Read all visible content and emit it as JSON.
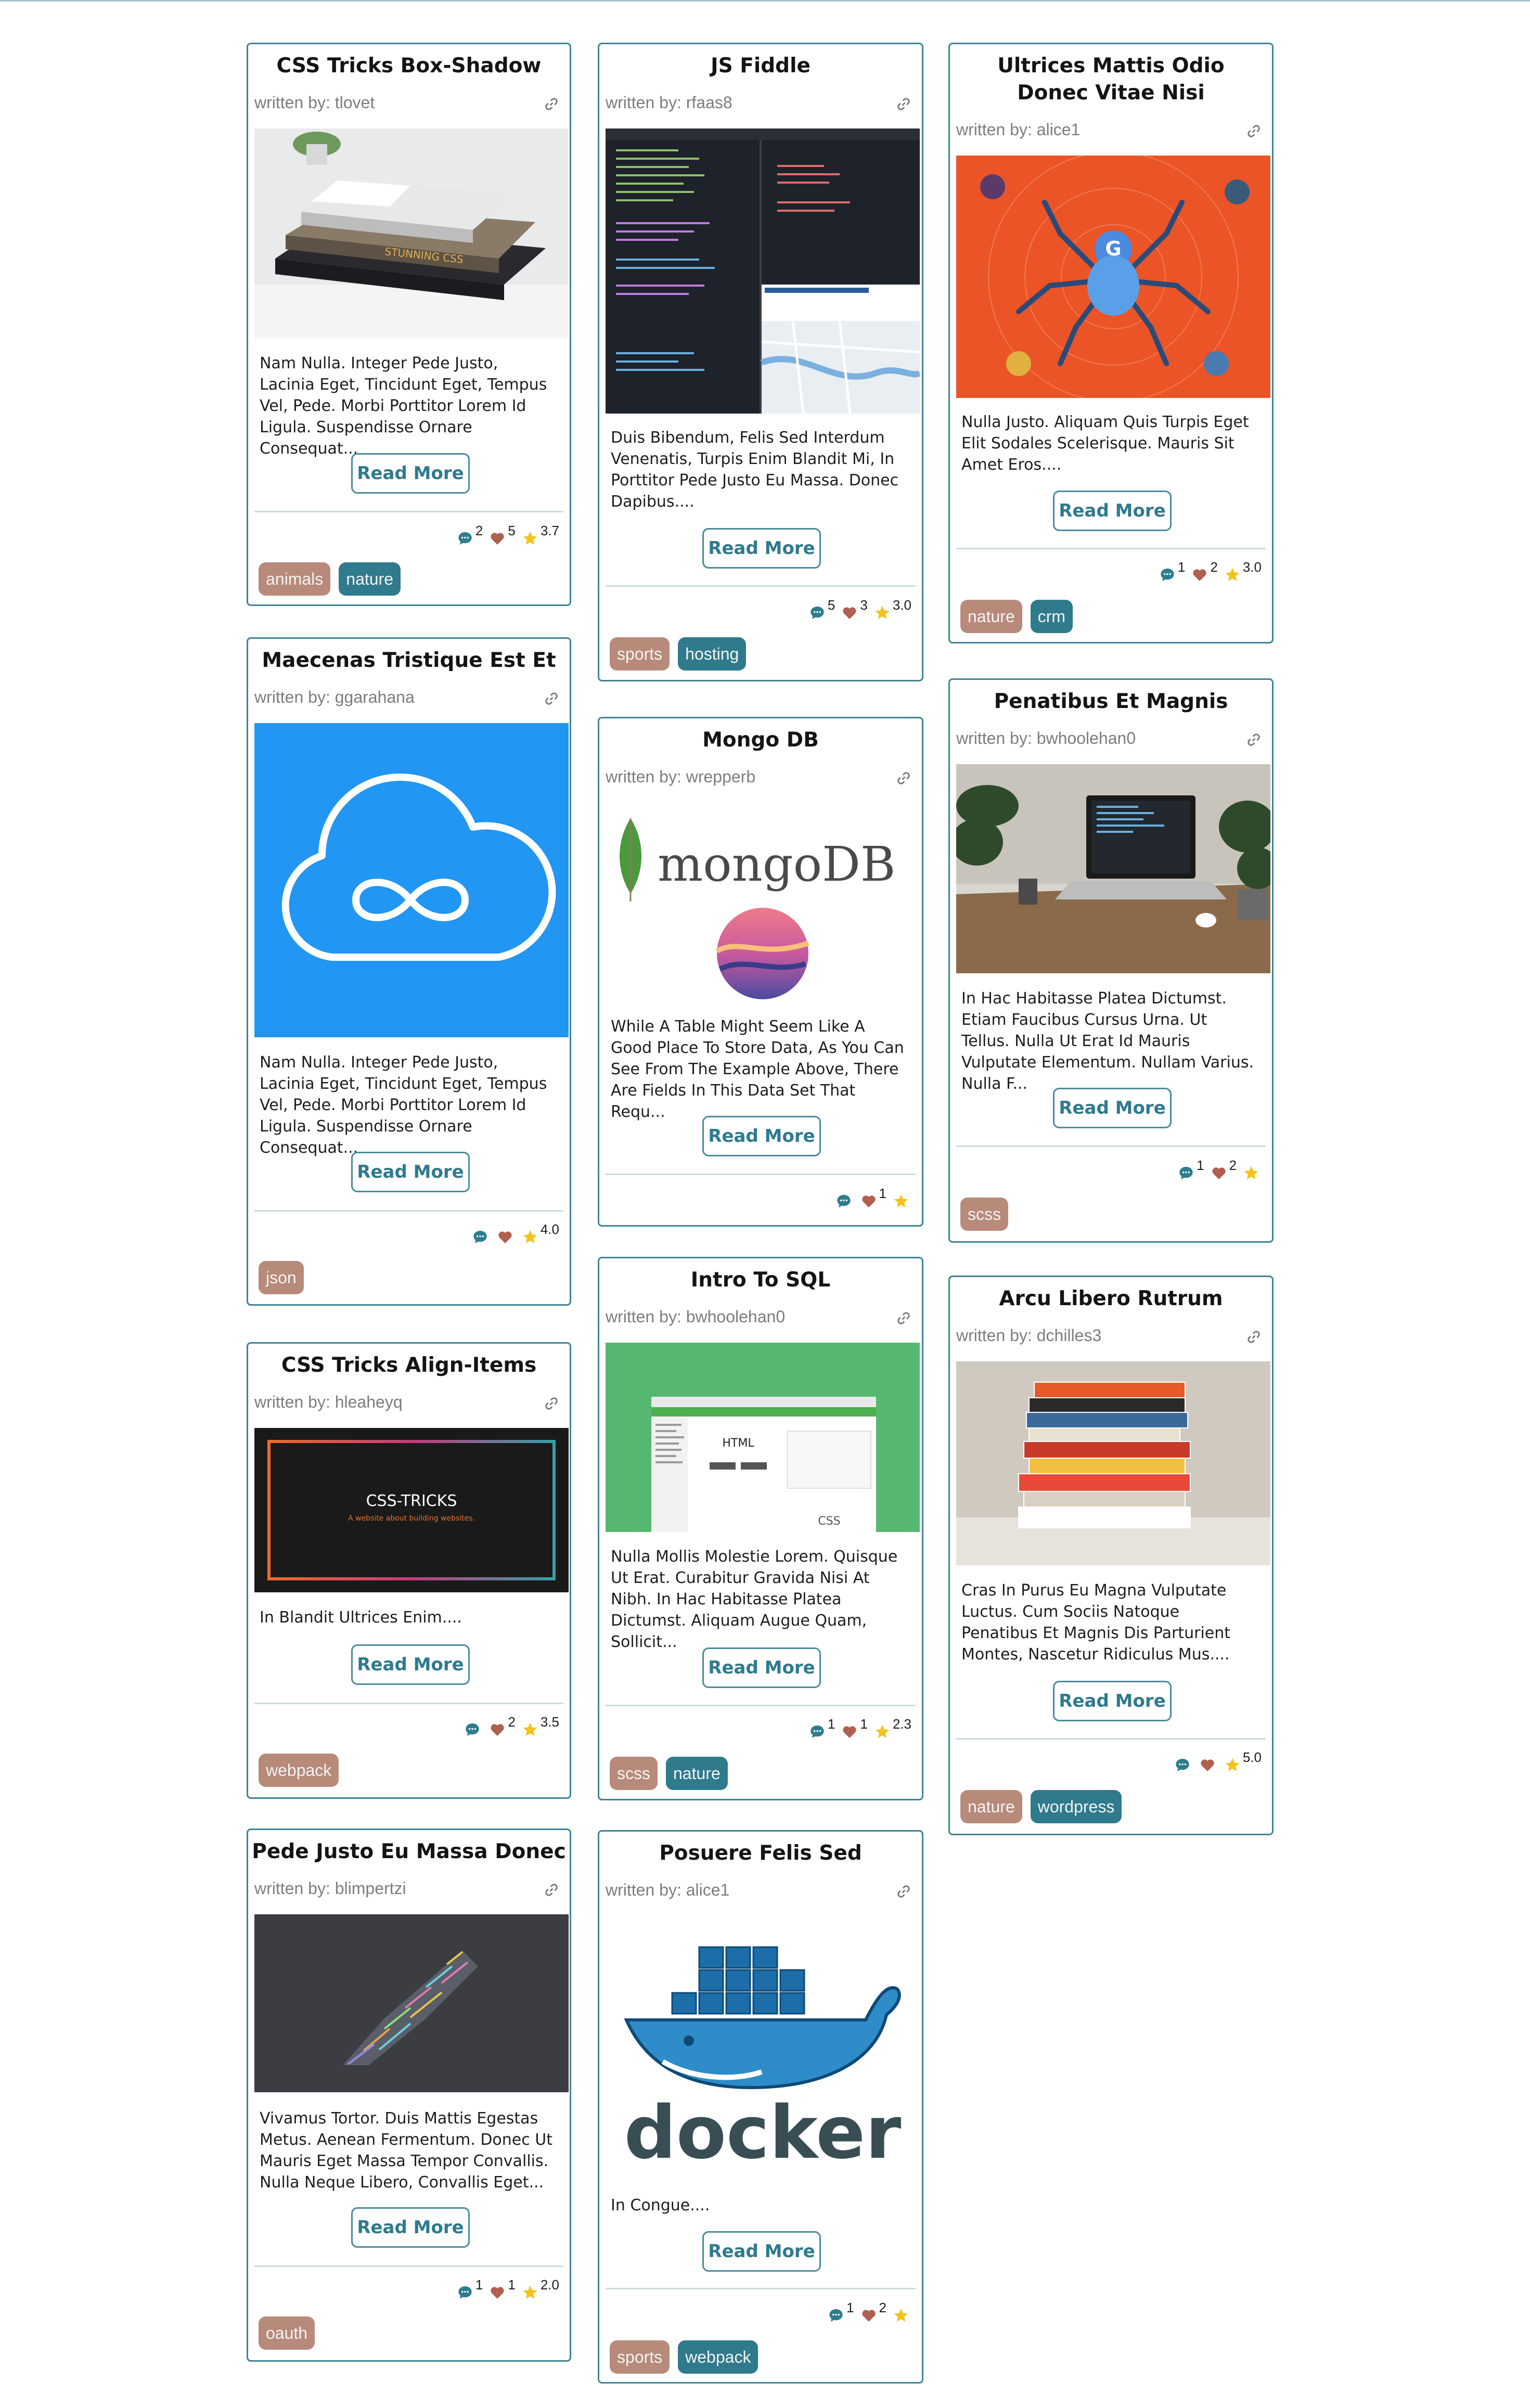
{
  "colors": {
    "card_border": "#3f8496",
    "button_text": "#2f7a8f",
    "comment_icon": "#2e7d8f",
    "heart_icon": "#b0604f",
    "star_icon": "#f2c31b",
    "tag_brown": "#b88a7a",
    "tag_teal": "#2f7a8c"
  },
  "cards": [
    {
      "title": "CSS Tricks Box-Shadow",
      "author": "written by: tlovet",
      "image": "stacked-css-books-photo",
      "excerpt": "Nam Nulla. Integer Pede Justo, Lacinia Eget, Tincidunt Eget, Tempus Vel, Pede. Morbi Porttitor Lorem Id Ligula. Suspendisse Ornare Consequat...",
      "button": "Read More",
      "comments": "2",
      "likes": "5",
      "rating": "3.7",
      "tags": [
        {
          "label": "animals",
          "color": "#b88a7a"
        },
        {
          "label": "nature",
          "color": "#2f7a8c"
        }
      ]
    },
    {
      "title": "Maecenas Tristique Est Et",
      "author": "written by: ggarahana",
      "image": "cloud-infinity-logo",
      "excerpt": "Nam Nulla. Integer Pede Justo, Lacinia Eget, Tincidunt Eget, Tempus Vel, Pede. Morbi Porttitor Lorem Id Ligula. Suspendisse Ornare Consequat...",
      "button": "Read More",
      "comments": "",
      "likes": "",
      "rating": "4.0",
      "tags": [
        {
          "label": "json",
          "color": "#b88a7a"
        }
      ]
    },
    {
      "title": "CSS Tricks Align-Items",
      "author": "written by: hleaheyq",
      "image": "css-tricks-banner",
      "image_text": "CSS-TRICKS",
      "image_subtext": "A website about building websites.",
      "excerpt": "In Blandit Ultrices Enim....",
      "button": "Read More",
      "comments": "",
      "likes": "2",
      "rating": "3.5",
      "tags": [
        {
          "label": "webpack",
          "color": "#b88a7a"
        }
      ]
    },
    {
      "title": "Pede Justo Eu Massa Donec",
      "author": "written by: blimpertzi",
      "image": "code-rocket-art",
      "excerpt": "Vivamus Tortor. Duis Mattis Egestas Metus. Aenean Fermentum. Donec Ut Mauris Eget Massa Tempor Convallis. Nulla Neque Libero, Convallis Eget...",
      "button": "Read More",
      "comments": "1",
      "likes": "1",
      "rating": "2.0",
      "tags": [
        {
          "label": "oauth",
          "color": "#b88a7a"
        }
      ]
    },
    {
      "title": "JS Fiddle",
      "author": "written by: rfaas8",
      "image": "jsfiddle-editor-screenshot",
      "excerpt": "Duis Bibendum, Felis Sed Interdum Venenatis, Turpis Enim Blandit Mi, In Porttitor Pede Justo Eu Massa. Donec Dapibus....",
      "button": "Read More",
      "comments": "5",
      "likes": "3",
      "rating": "3.0",
      "tags": [
        {
          "label": "sports",
          "color": "#b88a7a"
        },
        {
          "label": "hosting",
          "color": "#2f7a8c"
        }
      ]
    },
    {
      "title": "Mongo DB",
      "author": "written by: wrepperb",
      "image": "mongodb-logo",
      "image_text": "mongoDB",
      "excerpt": "While A Table Might Seem Like A Good Place To Store Data, As You Can See From The Example Above, There Are Fields In This Data Set That Requ...",
      "button": "Read More",
      "comments": "",
      "likes": "1",
      "rating": "",
      "tags": []
    },
    {
      "title": "Intro To SQL",
      "author": "written by: bwhoolehan0",
      "image": "w3schools-html-screenshot",
      "image_text": "HTML",
      "image_subtext": "CSS",
      "excerpt": "Nulla Mollis Molestie Lorem. Quisque Ut Erat. Curabitur Gravida Nisi At Nibh. In Hac Habitasse Platea Dictumst. Aliquam Augue Quam, Sollicit...",
      "button": "Read More",
      "comments": "1",
      "likes": "1",
      "rating": "2.3",
      "tags": [
        {
          "label": "scss",
          "color": "#b88a7a"
        },
        {
          "label": "nature",
          "color": "#2f7a8c"
        }
      ]
    },
    {
      "title": "Posuere Felis Sed",
      "author": "written by: alice1",
      "image": "docker-whale-logo",
      "image_text": "docker",
      "excerpt": "In Congue....",
      "button": "Read More",
      "comments": "1",
      "likes": "2",
      "rating": "",
      "tags": [
        {
          "label": "sports",
          "color": "#b88a7a"
        },
        {
          "label": "webpack",
          "color": "#2f7a8c"
        }
      ]
    },
    {
      "title": "Ultrices Mattis Odio Donec Vitae Nisi",
      "author": "written by: alice1",
      "image": "google-spider-illustration",
      "excerpt": "Nulla Justo. Aliquam Quis Turpis Eget Elit Sodales Scelerisque. Mauris Sit Amet Eros....",
      "button": "Read More",
      "comments": "1",
      "likes": "2",
      "rating": "3.0",
      "tags": [
        {
          "label": "nature",
          "color": "#b88a7a"
        },
        {
          "label": "crm",
          "color": "#2f7a8c"
        }
      ]
    },
    {
      "title": "Penatibus Et Magnis",
      "author": "written by: bwhoolehan0",
      "image": "laptop-desk-photo",
      "excerpt": "In Hac Habitasse Platea Dictumst. Etiam Faucibus Cursus Urna. Ut Tellus. Nulla Ut Erat Id Mauris Vulputate Elementum. Nullam Varius. Nulla F...",
      "button": "Read More",
      "comments": "1",
      "likes": "2",
      "rating": "",
      "tags": [
        {
          "label": "scss",
          "color": "#b88a7a"
        }
      ]
    },
    {
      "title": "Arcu Libero Rutrum",
      "author": "written by: dchilles3",
      "image": "business-books-stack-photo",
      "excerpt": "Cras In Purus Eu Magna Vulputate Luctus. Cum Sociis Natoque Penatibus Et Magnis Dis Parturient Montes, Nascetur Ridiculus Mus....",
      "button": "Read More",
      "comments": "",
      "likes": "",
      "rating": "5.0",
      "tags": [
        {
          "label": "nature",
          "color": "#b88a7a"
        },
        {
          "label": "wordpress",
          "color": "#2f7a8c"
        }
      ]
    }
  ]
}
